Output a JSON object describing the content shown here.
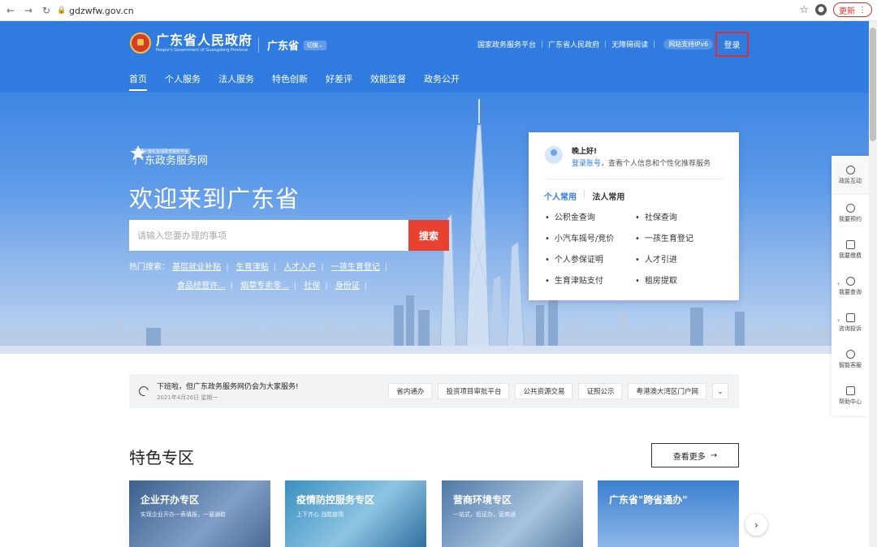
{
  "browser": {
    "url": "gdzwfw.gov.cn",
    "update_label": "更新"
  },
  "header": {
    "logo_cn": "广东省人民政府",
    "logo_en": "People's Government of Guangdong Province",
    "region": "广东省",
    "switch_label": "切换",
    "top_links": [
      "国家政务服务平台",
      "广东省人民政府",
      "无障碍阅读"
    ],
    "ipv6": "网站支持IPv6",
    "login": "登录",
    "nav": [
      "首页",
      "个人服务",
      "法人服务",
      "特色创新",
      "好差评",
      "效能监督",
      "政务公开"
    ]
  },
  "hero": {
    "brand_tag": "全国一体化在线政务服务平台",
    "brand_name": "广东政务服务网",
    "welcome": "欢迎来到广东省",
    "search_placeholder": "请输入您要办理的事项",
    "search_button": "搜索",
    "hot_label": "热门搜索：",
    "hot_row1": [
      "基层就业补贴",
      "生育津贴",
      "人才入户",
      "一孩生育登记"
    ],
    "hot_row2": [
      "食品经营许...",
      "烟草专卖零...",
      "社保",
      "身份证"
    ]
  },
  "card": {
    "greeting": "晚上好!",
    "login_link": "登录账号",
    "greeting_sub": "，查看个人信息和个性化推荐服务",
    "tab_personal": "个人常用",
    "tab_legal": "法人常用",
    "items": [
      "公积金查询",
      "社保查询",
      "小汽车摇号/竞价",
      "一孩生育登记",
      "个人参保证明",
      "人才引进",
      "生育津贴支付",
      "租房提取"
    ]
  },
  "side": [
    "政民互动",
    "我要预约",
    "我要缴费",
    "我要查询",
    "咨询投诉",
    "智能客服",
    "帮助中心"
  ],
  "notice": {
    "title": "下班啦，但广东政务服务网仍会为大家服务!",
    "date": "2021年4月26日 星期一",
    "links": [
      "省内通办",
      "投资项目审批平台",
      "公共资源交易",
      "证照公示",
      "粤港澳大湾区门户网"
    ]
  },
  "special": {
    "title": "特色专区",
    "see_more": "查看更多",
    "tiles": [
      {
        "title": "企业开办专区",
        "sub": "实现企业开办一表填报，一窗通取"
      },
      {
        "title": "疫情防控服务专区",
        "sub": "上下齐心 战胜疫情"
      },
      {
        "title": "营商环境专区",
        "sub": "一站式，低证办，营商通"
      },
      {
        "title": "广东省\"跨省通办\"",
        "sub": ""
      }
    ]
  },
  "colors": {
    "primary": "#2f7be0",
    "search_button": "#e8412f",
    "login_highlight": "#d92f2f"
  }
}
